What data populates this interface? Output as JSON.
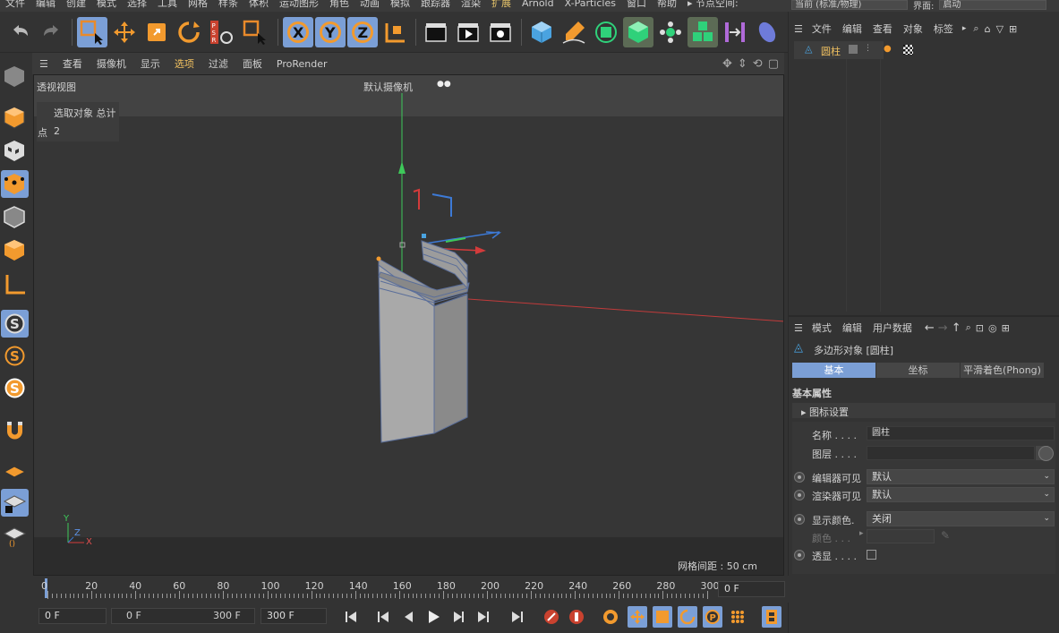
{
  "menu": [
    "文件",
    "编辑",
    "创建",
    "模式",
    "选择",
    "工具",
    "网格",
    "样条",
    "体积",
    "运动图形",
    "角色",
    "动画",
    "模拟",
    "跟踪器",
    "渲染",
    "扩展",
    "Arnold",
    "X-Particles",
    "窗口",
    "帮助",
    "▸ 节点空间:"
  ],
  "right_top": {
    "mode_value": "当前 (标准/物理)",
    "layout_label": "界面:",
    "layout_value": "启动"
  },
  "viewport_menu": {
    "items": [
      "查看",
      "摄像机",
      "显示",
      "选项",
      "过滤",
      "面板",
      "ProRender"
    ],
    "selected": "选项"
  },
  "viewport": {
    "name": "透视视图",
    "camera": "默认摄像机",
    "hud_title": "选取对象 总计",
    "hud_points_label": "点",
    "hud_points_value": "2",
    "grid_spacing": "网格间距 : 50 cm",
    "axis_x": "X",
    "axis_y": "Y",
    "axis_z": "Z"
  },
  "object_manager": {
    "menu": [
      "文件",
      "编辑",
      "查看",
      "对象",
      "标签"
    ],
    "object_name": "圆柱"
  },
  "attributes": {
    "menu": [
      "模式",
      "编辑",
      "用户数据"
    ],
    "title": "多边形对象 [圆柱]",
    "tabs": [
      "基本",
      "坐标",
      "平滑着色(Phong)"
    ],
    "active_tab": "基本",
    "section": "基本属性",
    "subsection": "▸ 图标设置",
    "name_label": "名称 . . . .",
    "name_value": "圆柱",
    "layer_label": "图层 . . . .",
    "editor_visible_label": "编辑器可见",
    "editor_visible_value": "默认",
    "render_visible_label": "渲染器可见",
    "render_visible_value": "默认",
    "display_color_label": "显示颜色.",
    "display_color_value": "关闭",
    "color_label": "颜色 . . .",
    "xray_label": "透显 . . . ."
  },
  "timeline": {
    "ticks": [
      "0",
      "20",
      "40",
      "60",
      "80",
      "100",
      "120",
      "140",
      "160",
      "180",
      "200",
      "220",
      "240",
      "260",
      "280",
      "300"
    ],
    "current_frame": "0 F"
  },
  "transport": {
    "start": "0 F",
    "range_start": "0 F",
    "range_end": "300 F",
    "end": "300 F"
  },
  "colors": {
    "accent": "#7b9fd6",
    "axis_x": "#d33b3b",
    "axis_y": "#3ec95a",
    "axis_z": "#3d7ad6",
    "highlight": "#f0c060"
  }
}
